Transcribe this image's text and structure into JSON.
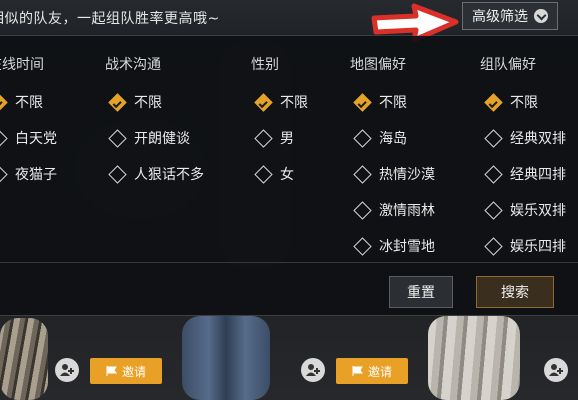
{
  "topbar": {
    "hint": "相似的队友，一起组队胜率更高哦~",
    "advanced_button": "高级筛选",
    "advanced_icon": "chevron-down-circle-icon",
    "annotation_arrow_color": "#d9302a"
  },
  "filters": {
    "columns": [
      {
        "title": "在线时间",
        "options": [
          {
            "label": "不限",
            "checked": true
          },
          {
            "label": "白天党",
            "checked": false
          },
          {
            "label": "夜猫子",
            "checked": false
          }
        ]
      },
      {
        "title": "战术沟通",
        "options": [
          {
            "label": "不限",
            "checked": true
          },
          {
            "label": "开朗健谈",
            "checked": false
          },
          {
            "label": "人狠话不多",
            "checked": false
          }
        ]
      },
      {
        "title": "性别",
        "options": [
          {
            "label": "不限",
            "checked": true
          },
          {
            "label": "男",
            "checked": false
          },
          {
            "label": "女",
            "checked": false
          }
        ]
      },
      {
        "title": "地图偏好",
        "options": [
          {
            "label": "不限",
            "checked": true
          },
          {
            "label": "海岛",
            "checked": false
          },
          {
            "label": "热情沙漠",
            "checked": false
          },
          {
            "label": "激情雨林",
            "checked": false
          },
          {
            "label": "冰封雪地",
            "checked": false
          }
        ]
      },
      {
        "title": "组队偏好",
        "options": [
          {
            "label": "不限",
            "checked": true
          },
          {
            "label": "经典双排",
            "checked": false
          },
          {
            "label": "经典四排",
            "checked": false
          },
          {
            "label": "娱乐双排",
            "checked": false
          },
          {
            "label": "娱乐四排",
            "checked": false
          }
        ]
      }
    ],
    "reset_label": "重置",
    "search_label": "搜索"
  },
  "invite_bar": {
    "invite_label": "邀请",
    "accent_color": "#e9a026"
  }
}
